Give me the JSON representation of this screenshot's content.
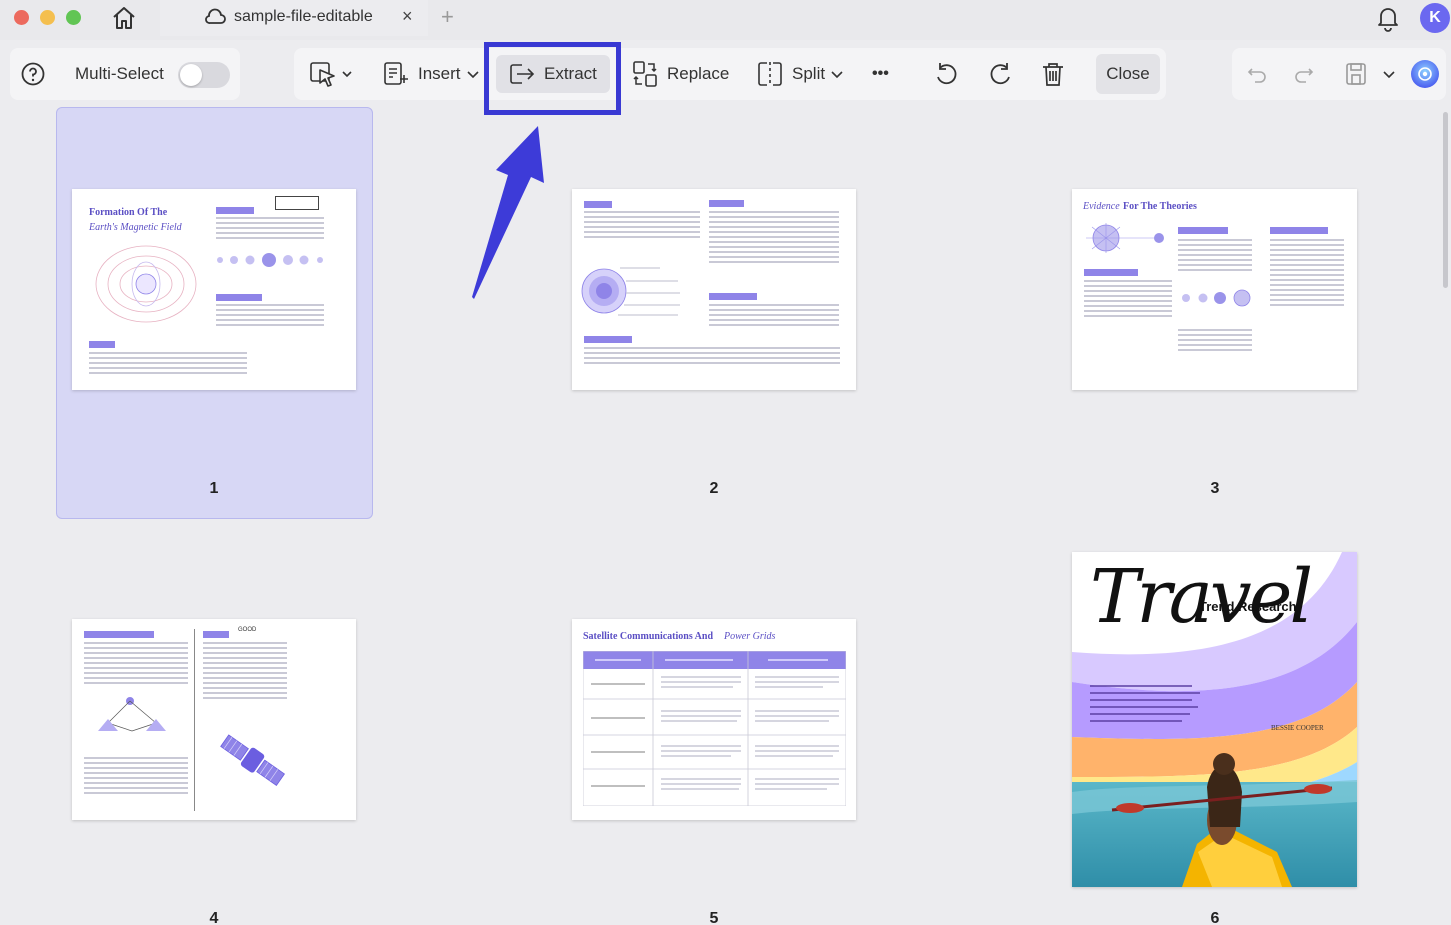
{
  "titlebar": {
    "tab_title": "sample-file-editable",
    "tab_close": "×",
    "new_tab": "+",
    "avatar_initial": "K"
  },
  "toolbar": {
    "multi_select_label": "Multi-Select",
    "multi_select_on": false,
    "insert_label": "Insert",
    "extract_label": "Extract",
    "replace_label": "Replace",
    "split_label": "Split",
    "more_label": "•••",
    "close_label": "Close"
  },
  "annotation": {
    "highlight_color": "#3939d3",
    "target": "extract-button"
  },
  "pages": [
    {
      "number": "1",
      "selected": true,
      "title_line1": "Formation Of The",
      "title_line2": "Earth's Magnetic Field"
    },
    {
      "number": "2",
      "selected": false
    },
    {
      "number": "3",
      "selected": false,
      "title_italic": "Evidence",
      "title_rest": "For The Theories"
    },
    {
      "number": "4",
      "selected": false,
      "label": "GOOD"
    },
    {
      "number": "5",
      "selected": false,
      "title_plain": "Satellite Communications And",
      "title_italic": "Power Grids"
    },
    {
      "number": "6",
      "selected": false,
      "cover_title": "Travel",
      "cover_subtitle": "Trend Research",
      "cover_author": "BESSIE COOPER"
    }
  ],
  "colors": {
    "accent": "#6b68f0",
    "selection": "#d7d7f5",
    "page_title": "#5b4fc4"
  }
}
